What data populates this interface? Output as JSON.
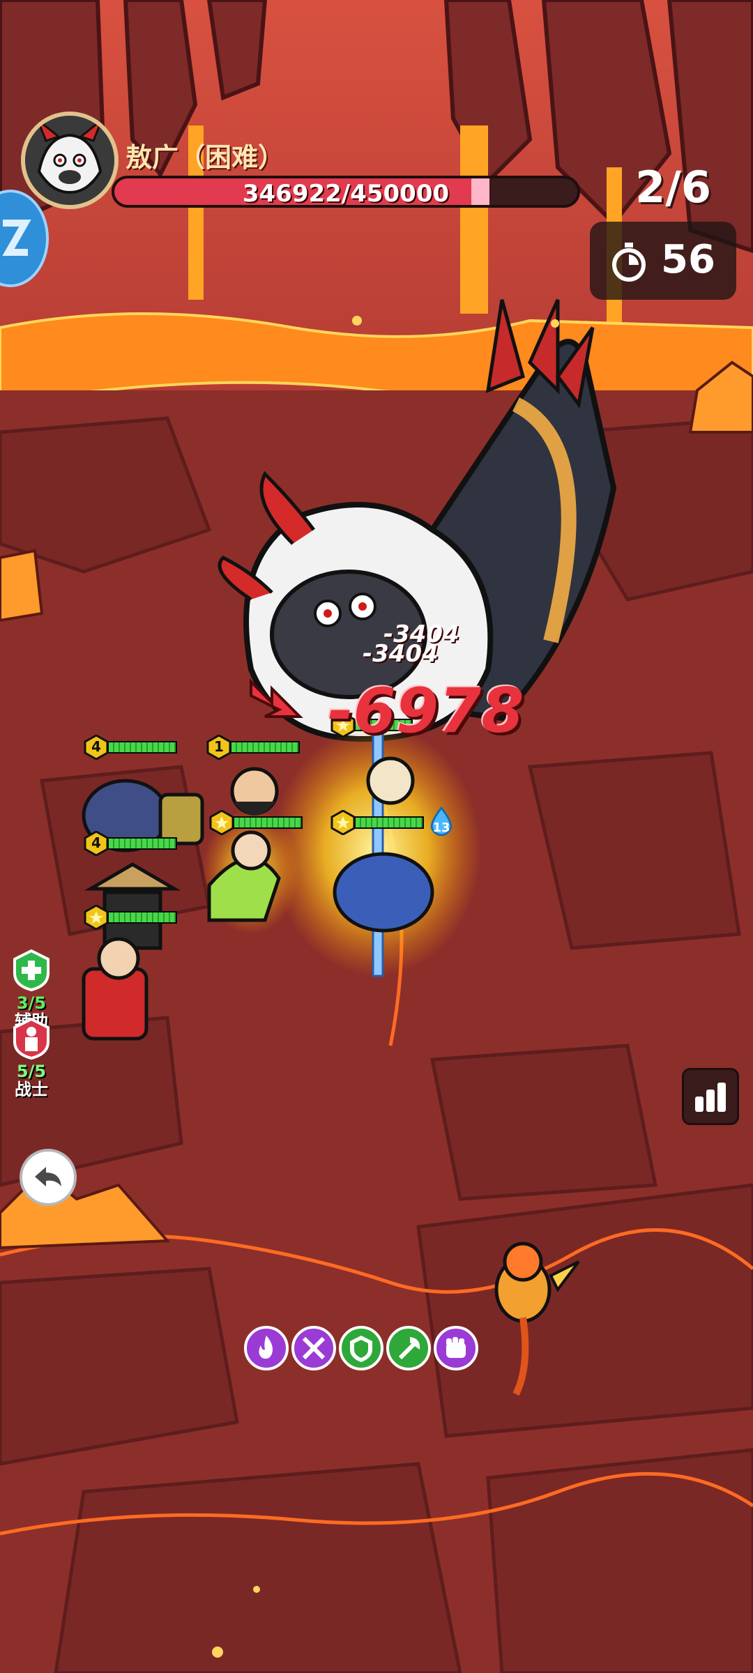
{
  "boss": {
    "name": "敖广（困难）",
    "hp_text": "346922/450000",
    "hp_current": 346922,
    "hp_max": 450000,
    "hp_recent_loss_fraction": 0.04,
    "portrait_icon": "dragon-king-portrait"
  },
  "wave": {
    "text": "2/6"
  },
  "timer": {
    "value": "56",
    "icon": "stopwatch-icon"
  },
  "damage_numbers": {
    "big": "-6978",
    "small_1": "-3404",
    "small_2": "-3404"
  },
  "units": [
    {
      "level": "4",
      "hp_fraction": 1.0
    },
    {
      "level": "1",
      "hp_fraction": 1.0
    },
    {
      "level": "",
      "hp_fraction": 1.0
    },
    {
      "level": "",
      "hp_fraction": 1.0
    },
    {
      "level": "4",
      "hp_fraction": 1.0
    },
    {
      "level": "",
      "hp_fraction": 1.0
    },
    {
      "level": "",
      "hp_fraction": 1.0
    }
  ],
  "class_badges": {
    "support": {
      "count": "3/5",
      "label": "辅助",
      "icon": "cross-shield-icon",
      "color": "#2fb84a"
    },
    "warrior": {
      "count": "5/5",
      "label": "战士",
      "icon": "figure-shield-icon",
      "color": "#d8354a"
    }
  },
  "skills": [
    {
      "name": "fire-skill-icon",
      "color": "#9b3bd6"
    },
    {
      "name": "crossed-swords-skill-icon",
      "color": "#9b3bd6"
    },
    {
      "name": "shield-skill-icon",
      "color": "#2fa83a"
    },
    {
      "name": "axe-skill-icon",
      "color": "#2fa83a"
    },
    {
      "name": "fist-skill-icon",
      "color": "#9b3bd6"
    }
  ],
  "buttons": {
    "stats": "bar-chart-icon",
    "back": "back-arrow-icon"
  },
  "colors": {
    "lava": "#ff8a1e",
    "ground": "#8c2f2a",
    "boss_hp": "#e23a4e"
  }
}
